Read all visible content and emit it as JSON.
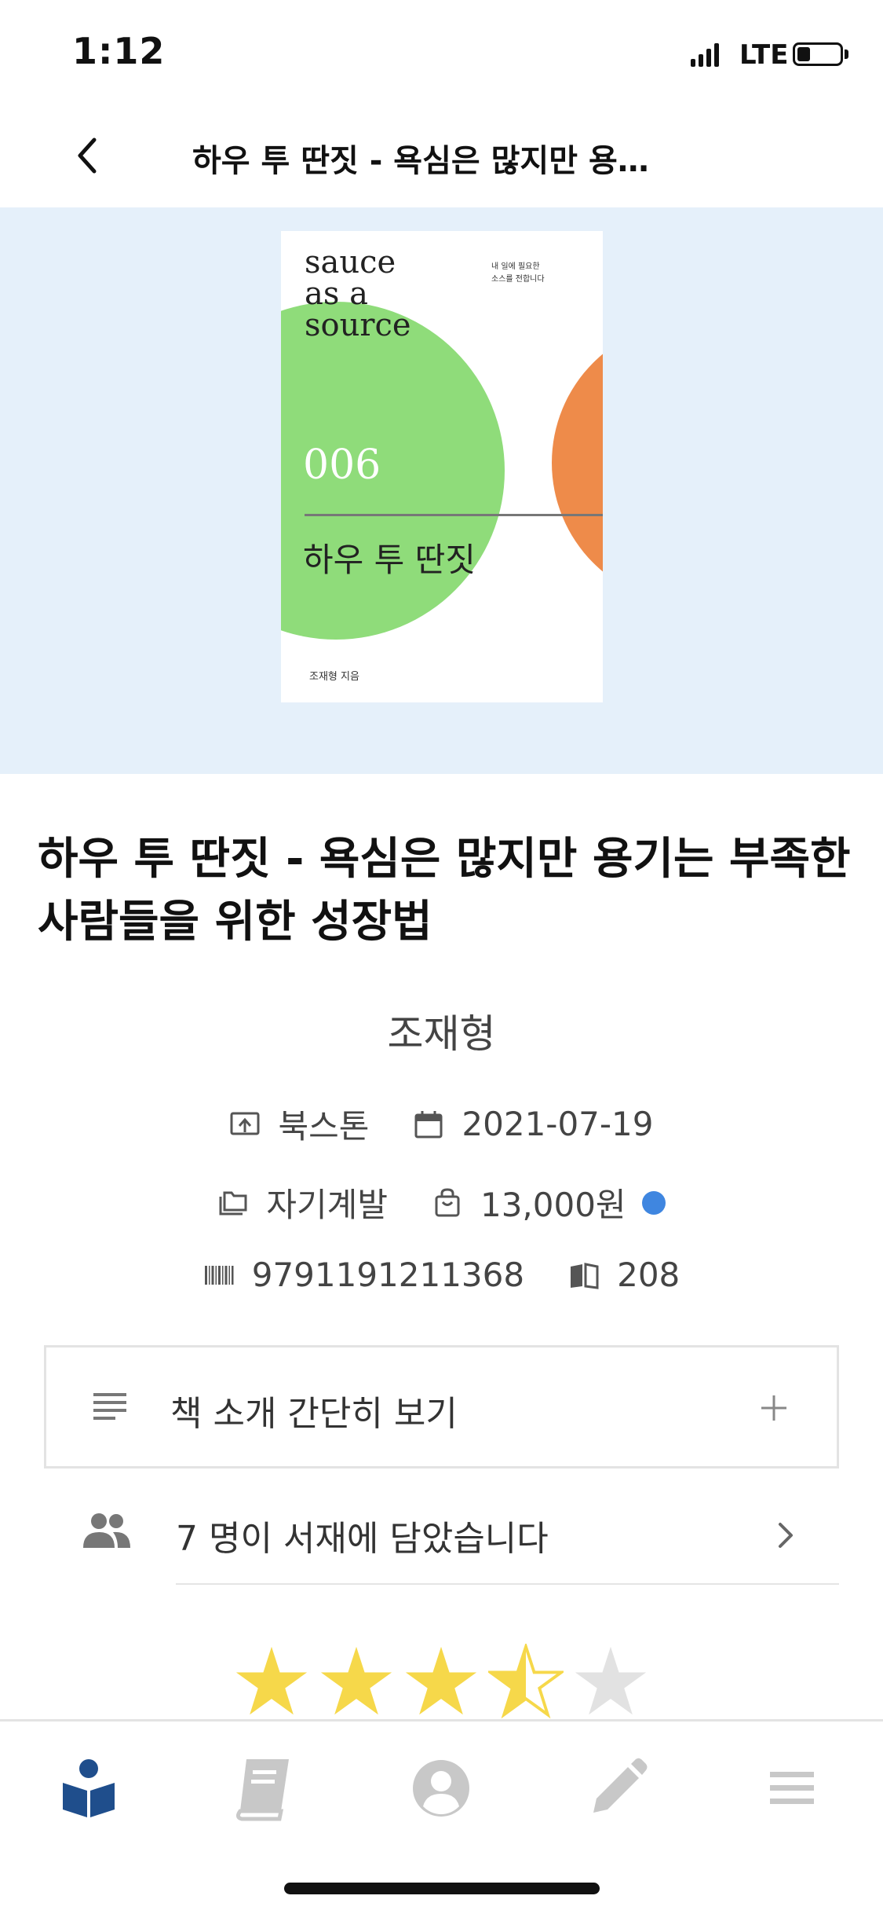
{
  "status_bar": {
    "time": "1:12",
    "network": "LTE"
  },
  "header": {
    "title": "하우 투 딴짓 - 욕심은 많지만 용…"
  },
  "cover": {
    "brand": "sauce\nas a\nsource",
    "tagline": "내 일에 필요한\n소스를 전합니다",
    "number": "006",
    "title": "하우 투 딴짓",
    "author": "조재형 지음",
    "colors": {
      "background": "#e5f0fa",
      "green": "#8fdc7a",
      "orange": "#ee8b4a"
    }
  },
  "book": {
    "title": "하우 투 딴짓 - 욕심은 많지만 용기는 부족한 사람들을 위한 성장법",
    "author": "조재형",
    "publisher": "북스톤",
    "date": "2021-07-19",
    "category": "자기계발",
    "price": "13,000원",
    "isbn": "9791191211368",
    "pages": "208"
  },
  "summary": {
    "label": "책 소개 간단히 보기",
    "icon": "notes-icon"
  },
  "likes": {
    "label": "7 명이 서재에 담았습니다",
    "icon": "people-icon"
  },
  "rating": {
    "value": 3.5,
    "max": 5,
    "colors": {
      "filled": "#f6d84a",
      "empty": "#e2e2e2"
    }
  },
  "tabbar": {
    "tabs": [
      {
        "name": "reading",
        "icon": "book-reader-icon",
        "active": true
      },
      {
        "name": "library",
        "icon": "book-icon",
        "active": false
      },
      {
        "name": "profile",
        "icon": "user-icon",
        "active": false
      },
      {
        "name": "write",
        "icon": "pencil-icon",
        "active": false
      },
      {
        "name": "menu",
        "icon": "menu-icon",
        "active": false
      }
    ],
    "colors": {
      "active": "#1f4e8c",
      "inactive": "#c8c8c8"
    }
  }
}
